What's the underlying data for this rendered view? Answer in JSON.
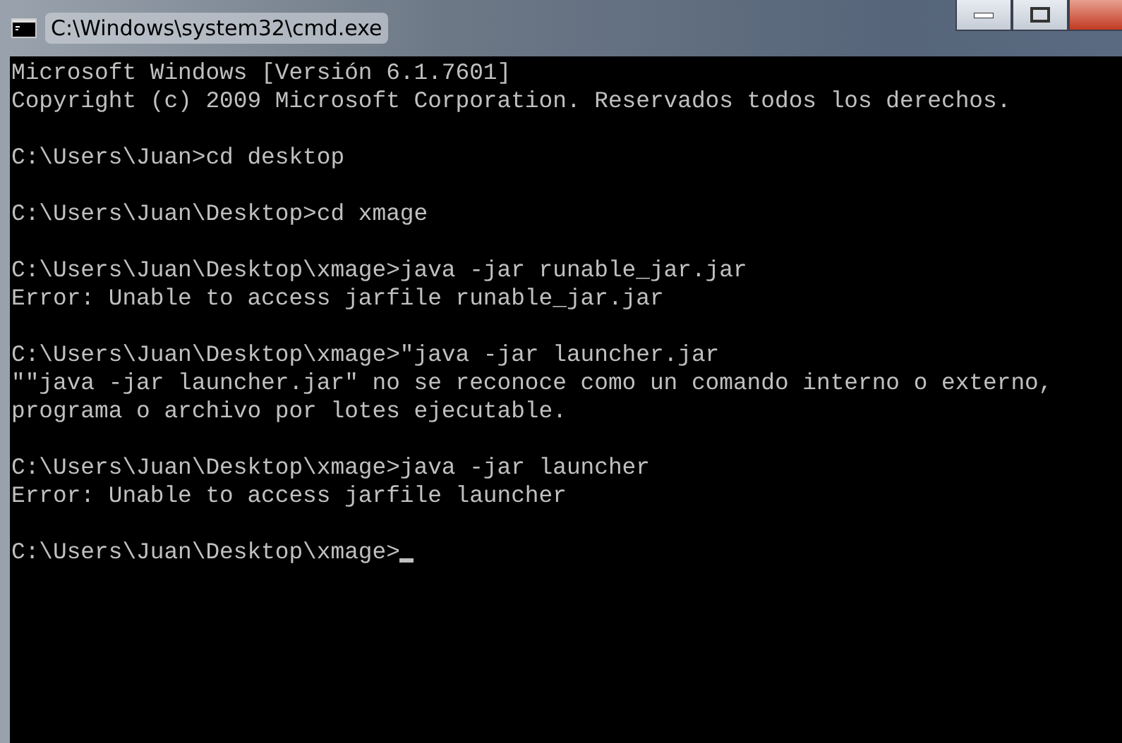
{
  "window": {
    "title": "C:\\Windows\\system32\\cmd.exe"
  },
  "console": {
    "blocks": [
      [
        "Microsoft Windows [Versión 6.1.7601]",
        "Copyright (c) 2009 Microsoft Corporation. Reservados todos los derechos."
      ],
      [
        "C:\\Users\\Juan>cd desktop"
      ],
      [
        "C:\\Users\\Juan\\Desktop>cd xmage"
      ],
      [
        "C:\\Users\\Juan\\Desktop\\xmage>java -jar runable_jar.jar",
        "Error: Unable to access jarfile runable_jar.jar"
      ],
      [
        "C:\\Users\\Juan\\Desktop\\xmage>\"java -jar launcher.jar",
        "\"\"java -jar launcher.jar\" no se reconoce como un comando interno o externo,",
        "programa o archivo por lotes ejecutable."
      ],
      [
        "C:\\Users\\Juan\\Desktop\\xmage>java -jar launcher",
        "Error: Unable to access jarfile launcher"
      ],
      [
        "C:\\Users\\Juan\\Desktop\\xmage>"
      ]
    ]
  }
}
